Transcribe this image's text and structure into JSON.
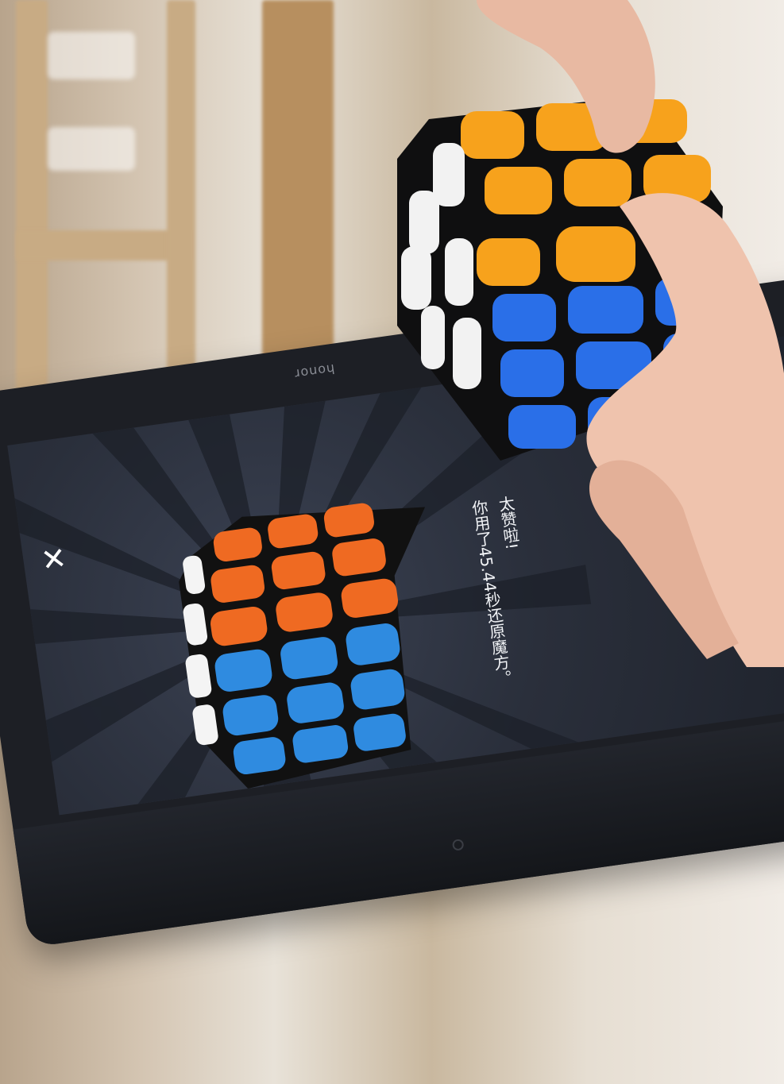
{
  "tablet": {
    "brand": "honor"
  },
  "app_screen": {
    "close_symbol": "✕",
    "message_line1": "太赞啦!",
    "message_line2": "你用了45.44秒还原魔方。"
  },
  "icons": {
    "close": "close-icon",
    "cube": "rubiks-cube-icon"
  },
  "colors": {
    "orange": "#ef6a22",
    "blue": "#2f8be0",
    "white": "#f4f4f4",
    "physical_orange": "#f7a21c",
    "physical_blue": "#2a6fe8"
  }
}
